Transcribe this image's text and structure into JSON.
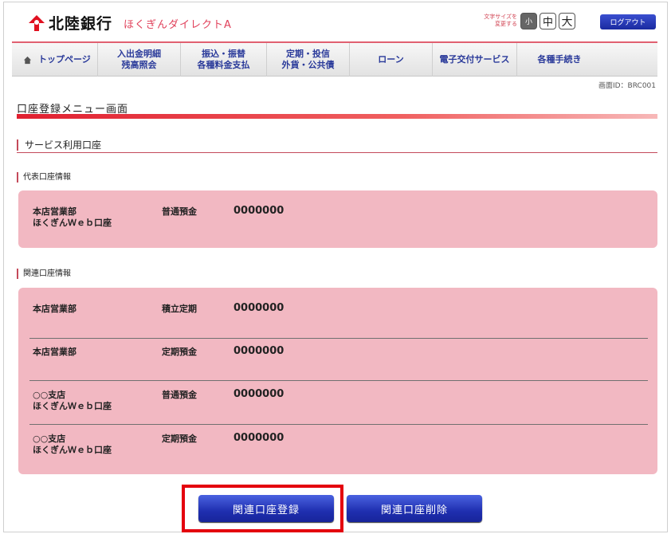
{
  "header": {
    "bank_name": "北陸銀行",
    "service_name": "ほくぎんダイレクトA",
    "font_size_label_1": "文字サイズを",
    "font_size_label_2": "変更する",
    "font_small": "小",
    "font_mid": "中",
    "font_large": "大",
    "logout": "ログアウト"
  },
  "nav": {
    "home": "トップページ",
    "item1_line1": "入出金明細",
    "item1_line2": "残高照会",
    "item2_line1": "振込・振替",
    "item2_line2": "各種料金支払",
    "item3_line1": "定期・投信",
    "item3_line2": "外貨・公共債",
    "item4": "ローン",
    "item5": "電子交付サービス",
    "item6": "各種手続き"
  },
  "screen_id": "画面ID：BRC001",
  "page_title": "口座登録メニュー画面",
  "section_title": "サービス利用口座",
  "representative": {
    "heading": "代表口座情報",
    "branch": "本店営業部",
    "sub": "ほくぎんＷｅｂ口座",
    "type": "普通預金",
    "number": "0000000"
  },
  "related": {
    "heading": "関連口座情報",
    "rows": [
      {
        "branch": "本店営業部",
        "sub": "",
        "type": "積立定期",
        "number": "0000000"
      },
      {
        "branch": "本店営業部",
        "sub": "",
        "type": "定期預金",
        "number": "0000000"
      },
      {
        "branch": "○○支店",
        "sub": "ほくぎんＷｅｂ口座",
        "type": "普通預金",
        "number": "0000000"
      },
      {
        "branch": "○○支店",
        "sub": "ほくぎんＷｅｂ口座",
        "type": "定期預金",
        "number": "0000000"
      }
    ]
  },
  "buttons": {
    "register": "関連口座登録",
    "delete": "関連口座削除"
  },
  "colors": {
    "accent_red": "#e02030",
    "panel_pink": "#f2b8c2",
    "nav_blue": "#2a3a9a",
    "button_blue": "#1f2fb0",
    "highlight_red": "#e4000e"
  }
}
